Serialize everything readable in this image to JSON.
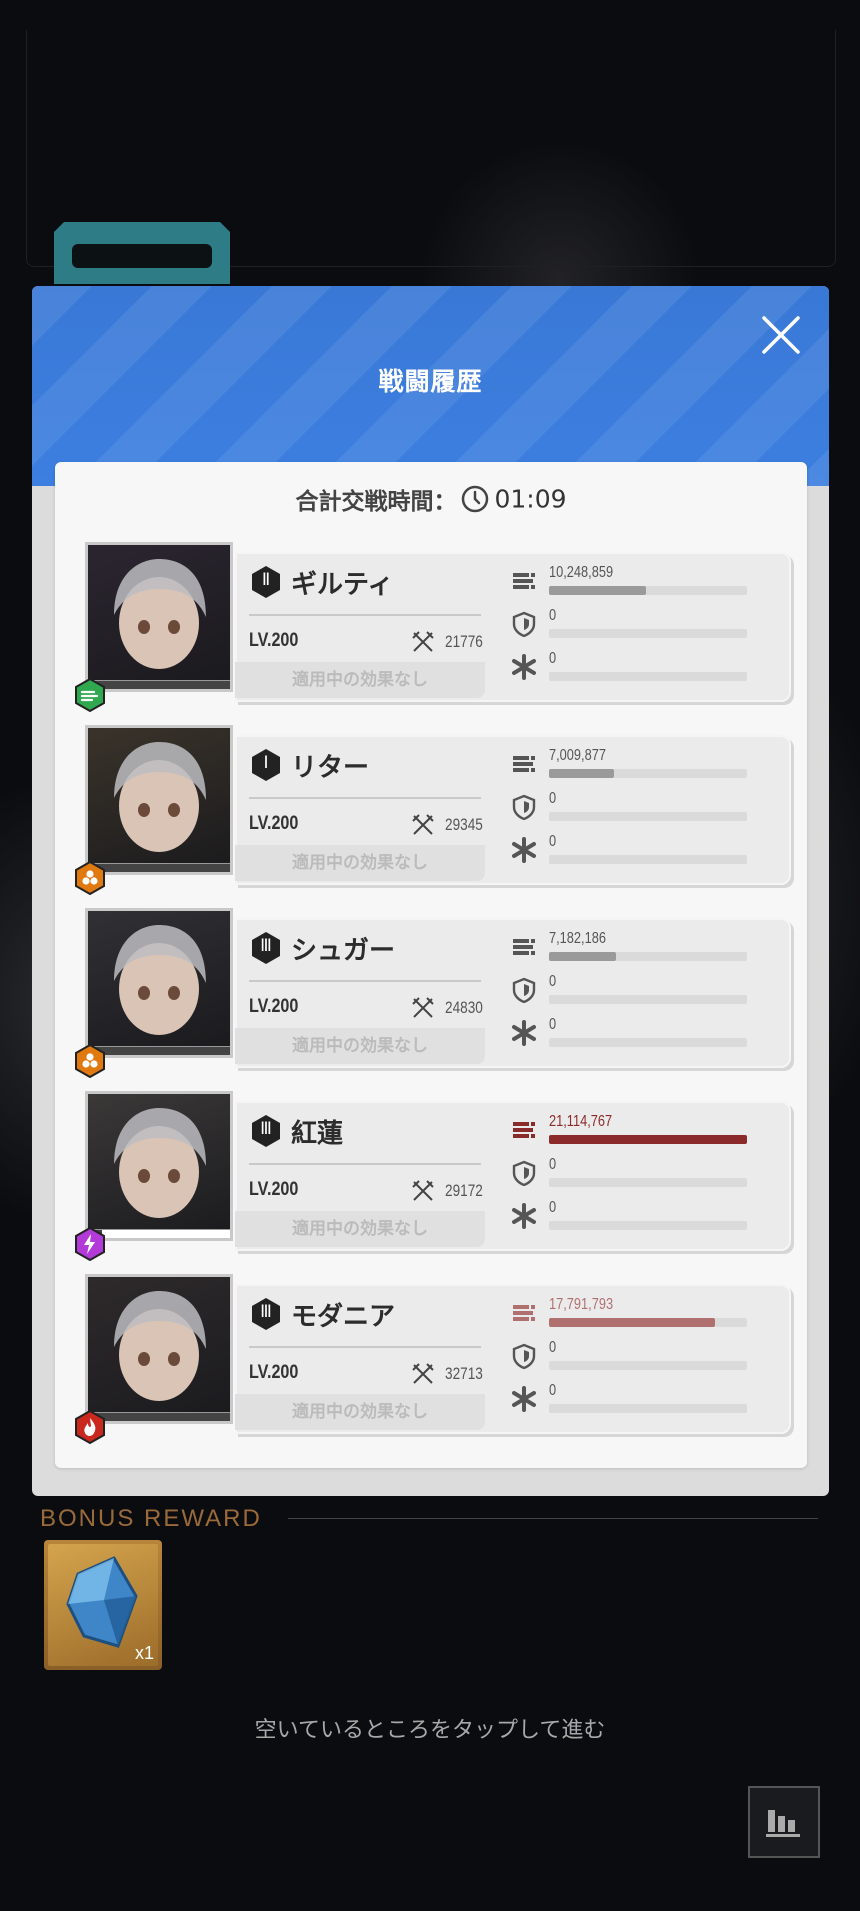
{
  "panel": {
    "title": "戦闘履歴",
    "total_time_label": "合計交戦時間：",
    "total_time_value": "01:09"
  },
  "units": [
    {
      "rank": "Ⅱ",
      "name": "ギルティ",
      "level": "LV.200",
      "power": "21776",
      "effect": "適用中の効果なし",
      "element": "wind",
      "element_color": "#2fa84f",
      "damage": "10,248,859",
      "damage_fraction": 0.49,
      "damage_color": "#9a9a9a",
      "shield": "0",
      "heal": "0",
      "hp_fraction": 1.0,
      "portrait_color": "#2b2530"
    },
    {
      "rank": "Ⅰ",
      "name": "リター",
      "level": "LV.200",
      "power": "29345",
      "effect": "適用中の効果なし",
      "element": "iron",
      "element_color": "#e07a10",
      "damage": "7,009,877",
      "damage_fraction": 0.33,
      "damage_color": "#9a9a9a",
      "shield": "0",
      "heal": "0",
      "hp_fraction": 1.0,
      "portrait_color": "#3a332a"
    },
    {
      "rank": "Ⅲ",
      "name": "シュガー",
      "level": "LV.200",
      "power": "24830",
      "effect": "適用中の効果なし",
      "element": "iron",
      "element_color": "#e07a10",
      "damage": "7,182,186",
      "damage_fraction": 0.34,
      "damage_color": "#9a9a9a",
      "shield": "0",
      "heal": "0",
      "hp_fraction": 1.0,
      "portrait_color": "#303035"
    },
    {
      "rank": "Ⅲ",
      "name": "紅蓮",
      "level": "LV.200",
      "power": "29172",
      "effect": "適用中の効果なし",
      "element": "electric",
      "element_color": "#b23ad8",
      "damage": "21,114,767",
      "damage_fraction": 1.0,
      "damage_color": "#8b2a2a",
      "shield": "0",
      "heal": "0",
      "hp_fraction": 0.1,
      "portrait_color": "#3b3838"
    },
    {
      "rank": "Ⅲ",
      "name": "モダニア",
      "level": "LV.200",
      "power": "32713",
      "effect": "適用中の効果なし",
      "element": "fire",
      "element_color": "#c8281e",
      "damage": "17,791,793",
      "damage_fraction": 0.84,
      "damage_color": "#b07070",
      "shield": "0",
      "heal": "0",
      "hp_fraction": 1.0,
      "portrait_color": "#2e2a2c"
    }
  ],
  "bonus": {
    "label": "BONUS REWARD",
    "item_qty": "x1",
    "item_icon": "crystal-icon"
  },
  "hint": "空いているところをタップして進む",
  "icons": {
    "close": "close-icon",
    "clock": "clock-icon",
    "power": "crossed-swords-icon",
    "damage": "bullets-icon",
    "shield": "shield-icon",
    "heal": "asterisk-icon",
    "stats": "bar-chart-icon"
  }
}
